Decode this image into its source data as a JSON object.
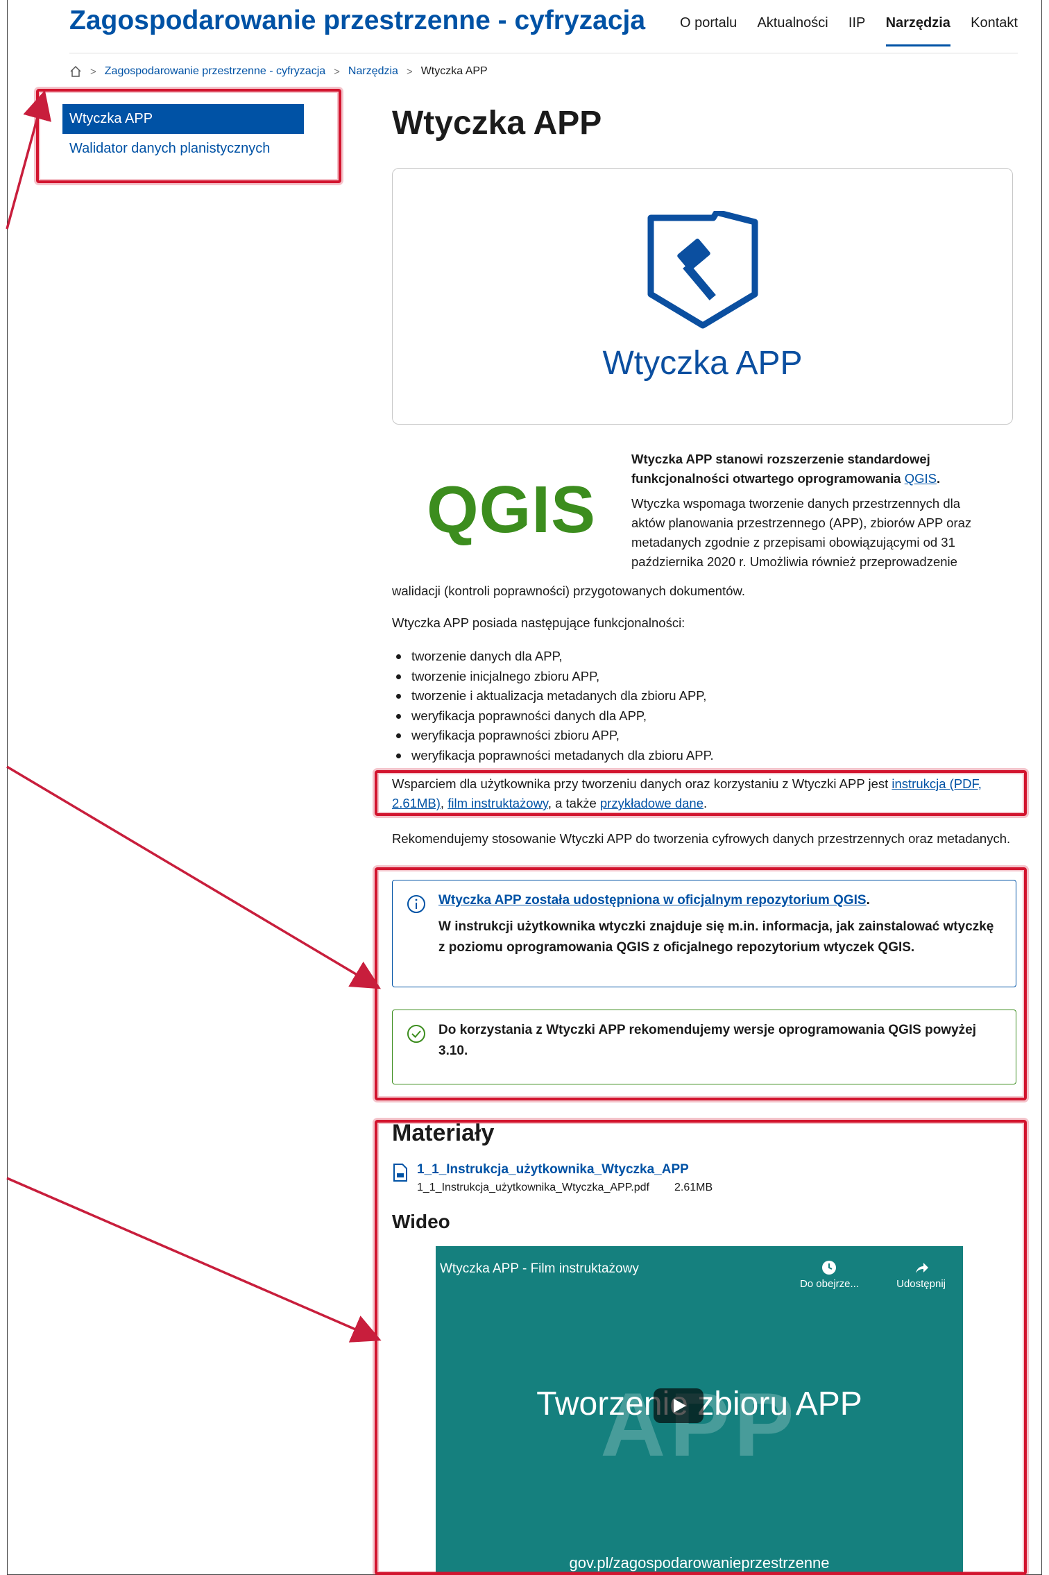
{
  "header": {
    "site_title": "Zagospodarowanie przestrzenne - cyfryzacja",
    "nav": [
      "O portalu",
      "Aktualności",
      "IIP",
      "Narzędzia",
      "Kontakt"
    ],
    "nav_active": "Narzędzia"
  },
  "breadcrumb": {
    "home_icon": "home-icon",
    "items": [
      "Zagospodarowanie przestrzenne - cyfryzacja",
      "Narzędzia",
      "Wtyczka APP"
    ],
    "separator": ">"
  },
  "sidebar": {
    "items": [
      {
        "label": "Wtyczka APP",
        "active": true
      },
      {
        "label": "Walidator danych planistycznych",
        "active": false
      }
    ]
  },
  "main": {
    "title": "Wtyczka APP",
    "hero_caption": "Wtyczka APP",
    "qgis_logo": "QGIS",
    "intro_bold": "Wtyczka APP stanowi rozszerzenie standardowej funkcjonalności otwartego oprogramowania",
    "intro_bold_link": "QGIS",
    "intro_text": "Wtyczka wspomaga tworzenie danych przestrzennych dla aktów planowania przestrzennego (APP), zbiorów APP oraz metadanych zgodnie z przepisami obowiązującymi od 31 października 2020 r. Umożliwia również przeprowadzenie",
    "intro_text_cont": "walidacji (kontroli poprawności) przygotowanych dokumentów.",
    "features_intro": "Wtyczka APP posiada następujące funkcjonalności:",
    "features": [
      "tworzenie danych dla APP,",
      "tworzenie inicjalnego zbioru APP,",
      "tworzenie i aktualizacja metadanych dla zbioru APP,",
      "weryfikacja poprawności danych dla APP,",
      "weryfikacja poprawności zbioru APP,",
      "weryfikacja poprawności metadanych dla zbioru APP."
    ],
    "support": {
      "text_a": "Wsparciem dla użytkownika przy tworzeniu danych oraz korzystaniu z Wtyczki APP jest ",
      "link1": "instrukcja (PDF, 2.61MB)",
      "text_b": ", ",
      "link2": "film instruktażowy",
      "text_c": ", a także ",
      "link3": "przykładowe dane",
      "text_d": "."
    },
    "recommend": "Rekomendujemy stosowanie Wtyczki APP do tworzenia cyfrowych danych przestrzennych oraz metadanych.",
    "info_alert": {
      "link": "Wtyczka APP została udostępniona w oficjalnym repozytorium QGIS",
      "link_suffix": ".",
      "text": "W instrukcji użytkownika wtyczki znajduje się m.in. informacja, jak zainstalować wtyczkę z poziomu oprogramowania QGIS z oficjalnego repozytorium wtyczek QGIS."
    },
    "ok_alert": {
      "text": "Do korzystania z Wtyczki APP rekomendujemy wersje oprogramowania QGIS powyżej 3.10."
    },
    "materials_title": "Materiały",
    "download": {
      "name": "1_1_Instrukcja_użytkownika_Wtyczka_APP",
      "file": "1_1_Instrukcja_użytkownika_Wtyczka_APP.pdf",
      "size": "2.61MB"
    },
    "video_section_title": "Wideo",
    "video": {
      "title": "Wtyczka APP - Film instruktażowy",
      "watch_later": "Do obejrze...",
      "share": "Udostępnij",
      "bg_text": "APP",
      "headline": "Tworzenie zbioru APP",
      "footer": "gov.pl/zagospodarowanieprzestrzenne"
    }
  },
  "colors": {
    "brand": "#0052a5",
    "annotation": "#d2142e",
    "success": "#3c8d1e",
    "video_bg": "#15807e"
  }
}
